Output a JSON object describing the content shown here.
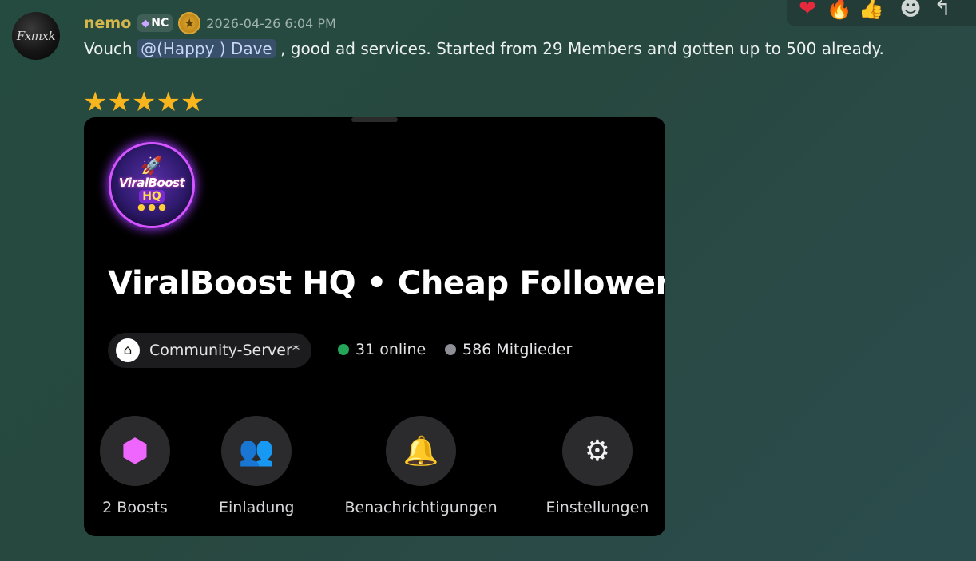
{
  "message": {
    "author": "nemo",
    "tag_label": "NC",
    "timestamp": "2026-04-26 6:04 PM",
    "avatar_text": "Fxmxk",
    "text_before": "Vouch ",
    "mention": "@(Happy ) Dave",
    "text_after": " ,  good ad services. Started from 29 Members and gotten up to 500 already.",
    "stars": "★★★★★"
  },
  "toolbar": {
    "reactions": [
      {
        "name": "heart",
        "glyph": "❤"
      },
      {
        "name": "fire",
        "glyph": "🔥"
      },
      {
        "name": "thumbs-up",
        "glyph": "👍"
      }
    ],
    "add_reaction_glyph": "☻",
    "reply_glyph": "↰"
  },
  "embed": {
    "server_icon_line1": "ViralBoost",
    "server_icon_line2": "HQ",
    "server_name": "ViralBoost HQ • Cheap Followers",
    "community_label": "Community-Server*",
    "online_label": "31 online",
    "members_label": "586 Mitglieder",
    "online_color": "#23a55a",
    "members_color": "#8e8e96",
    "actions": [
      {
        "name": "boosts",
        "label": "2 Boosts",
        "glyph": "⬢"
      },
      {
        "name": "invite",
        "label": "Einladung",
        "glyph": "👥"
      },
      {
        "name": "notifications",
        "label": "Benachrichtigungen",
        "glyph": "🔔"
      },
      {
        "name": "settings",
        "label": "Einstellungen",
        "glyph": "⚙"
      }
    ]
  },
  "colors": {
    "username": "#d3b74d",
    "mention_bg": "#38506a",
    "stars": "#f8b51e",
    "boost_accent": "#ef66ff"
  }
}
